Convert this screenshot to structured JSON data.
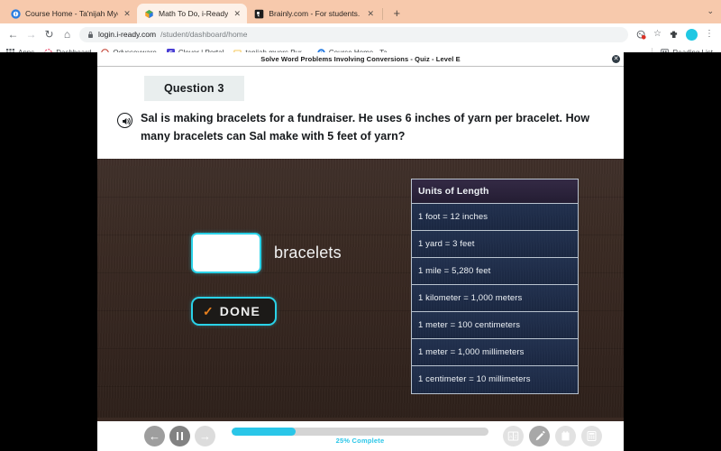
{
  "browser": {
    "tabs": [
      {
        "title": "Course Home - Ta'nijah Myers",
        "favicon": "iready-icon",
        "active": false
      },
      {
        "title": "Math To Do, i-Ready",
        "favicon": "cube-icon",
        "active": true
      },
      {
        "title": "Brainly.com - For students. By",
        "favicon": "brainly-icon",
        "active": false
      }
    ],
    "new_tab_label": "+",
    "tabstrip_chevron": "⌄",
    "nav": {
      "back": "←",
      "forward": "→",
      "reload": "↻",
      "home": "⌂"
    },
    "omnibox": {
      "lock_icon": "lock-icon",
      "host": "login.i-ready.com",
      "path": "/student/dashboard/home",
      "full_url": "login.i-ready.com/student/dashboard/home"
    },
    "omnibox_icons": [
      "cookie-blocked-icon",
      "star-icon",
      "extensions-icon",
      "profile-avatar",
      "kebab-menu-icon"
    ],
    "star_glyph": "☆",
    "puzzle_glyph": "✦",
    "kebab_glyph": "⋮",
    "bookmarks": [
      {
        "label": "Apps",
        "icon": "apps-grid-icon"
      },
      {
        "label": "Dashboard",
        "icon": "dashboard-icon"
      },
      {
        "label": "Odysseyware",
        "icon": "odysseyware-icon"
      },
      {
        "label": "Clever | Portal",
        "icon": "clever-icon"
      },
      {
        "label": "tanijah myers Pur...",
        "icon": "folder-icon"
      },
      {
        "label": "Course Home - Ta...",
        "icon": "iready-icon"
      }
    ],
    "reading_list": {
      "label": "Reading List",
      "icon": "reading-list-icon"
    }
  },
  "quiz": {
    "title": "Solve Word Problems Involving Conversions - Quiz - Level E",
    "close_label": "✕",
    "question_badge": "Question 3",
    "speaker_icon": "speaker-audio-icon",
    "question_text": "Sal is making bracelets for a fundraiser. He uses 6 inches of yarn per bracelet. How many bracelets can Sal make with 5 feet of yarn?",
    "answer": {
      "value": "",
      "placeholder": "",
      "unit_label": "bracelets"
    },
    "done_button": {
      "label": "DONE",
      "check_icon": "checkmark-icon",
      "check_glyph": "✓"
    },
    "units_table": {
      "header": "Units of Length",
      "rows": [
        "1 foot = 12 inches",
        "1 yard = 3 feet",
        "1 mile = 5,280 feet",
        "1 kilometer = 1,000 meters",
        "1 meter = 100 centimeters",
        "1 meter = 1,000 millimeters",
        "1 centimeter = 10 millimeters"
      ]
    },
    "toolbar": {
      "back_icon": "back-arrow-icon",
      "back_glyph": "←",
      "pause_icon": "pause-icon",
      "forward_icon": "forward-arrow-icon",
      "forward_glyph": "→",
      "progress_percent": 25,
      "progress_label": "25% Complete",
      "tools": [
        {
          "name": "glossary-icon",
          "label": "A|Z",
          "active": false
        },
        {
          "name": "pencil-icon",
          "label": "",
          "active": true
        },
        {
          "name": "notepad-icon",
          "label": "",
          "active": false
        },
        {
          "name": "calculator-icon",
          "label": "",
          "active": false
        }
      ]
    }
  },
  "colors": {
    "accent_cyan": "#2ac6e8",
    "tab_strip": "#f7c9ac",
    "wood_dark": "#3a2a23",
    "table_navy": "#1d2c49",
    "table_header": "#2b2338",
    "check_orange": "#e8801e"
  }
}
